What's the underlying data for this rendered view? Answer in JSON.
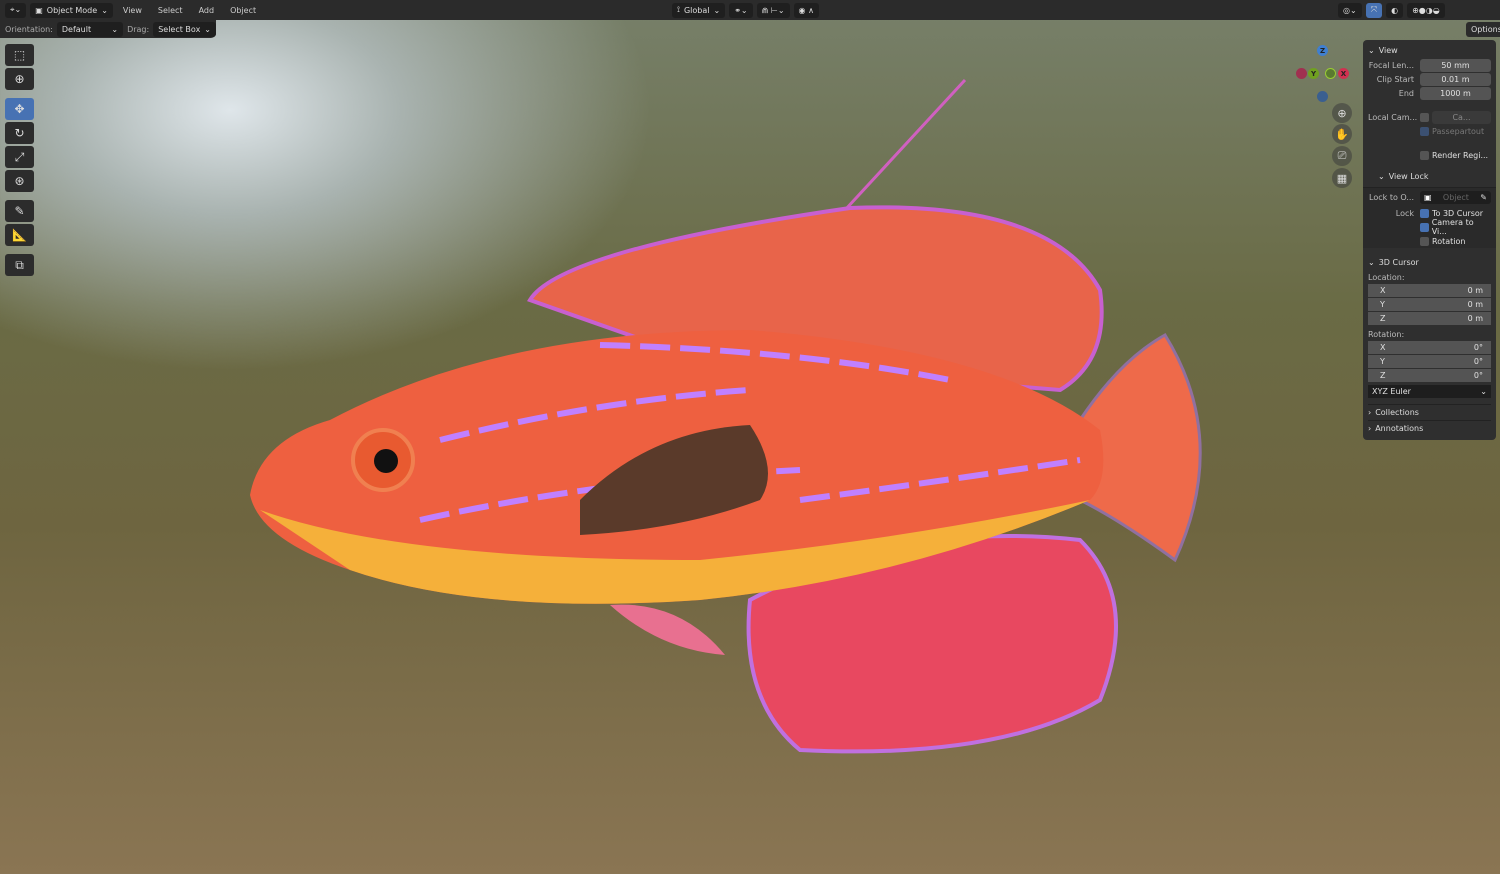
{
  "header": {
    "mode": "Object Mode",
    "menus": [
      "View",
      "Select",
      "Add",
      "Object"
    ],
    "orientation_global": "Global",
    "options": "Options"
  },
  "toolbar": {
    "orientation_label": "Orientation:",
    "orientation_value": "Default",
    "drag_label": "Drag:",
    "drag_value": "Select Box"
  },
  "gizmo": {
    "z": "Z",
    "y": "Y",
    "x": "X"
  },
  "sidebar": {
    "view": {
      "title": "View",
      "focal_label": "Focal Len...",
      "focal": "50 mm",
      "clip_start_label": "Clip Start",
      "clip_start": "0.01 m",
      "end_label": "End",
      "end": "1000 m",
      "local_cam_label": "Local Cam...",
      "local_cam_value": "Ca...",
      "passepartout": "Passepartout",
      "render_region": "Render Regi..."
    },
    "view_lock": {
      "title": "View Lock",
      "lock_to_label": "Lock to O...",
      "lock_to_placeholder": "Object",
      "lock_label": "Lock",
      "to_cursor": "To 3D Cursor",
      "camera_to_view": "Camera to Vi...",
      "rotation": "Rotation"
    },
    "cursor": {
      "title": "3D Cursor",
      "location_label": "Location:",
      "loc": [
        {
          "a": "X",
          "v": "0 m"
        },
        {
          "a": "Y",
          "v": "0 m"
        },
        {
          "a": "Z",
          "v": "0 m"
        }
      ],
      "rotation_label": "Rotation:",
      "rot": [
        {
          "a": "X",
          "v": "0°"
        },
        {
          "a": "Y",
          "v": "0°"
        },
        {
          "a": "Z",
          "v": "0°"
        }
      ],
      "mode": "XYZ Euler"
    },
    "collections": "Collections",
    "annotations": "Annotations"
  },
  "colors": {
    "accent": "#4772b3"
  }
}
